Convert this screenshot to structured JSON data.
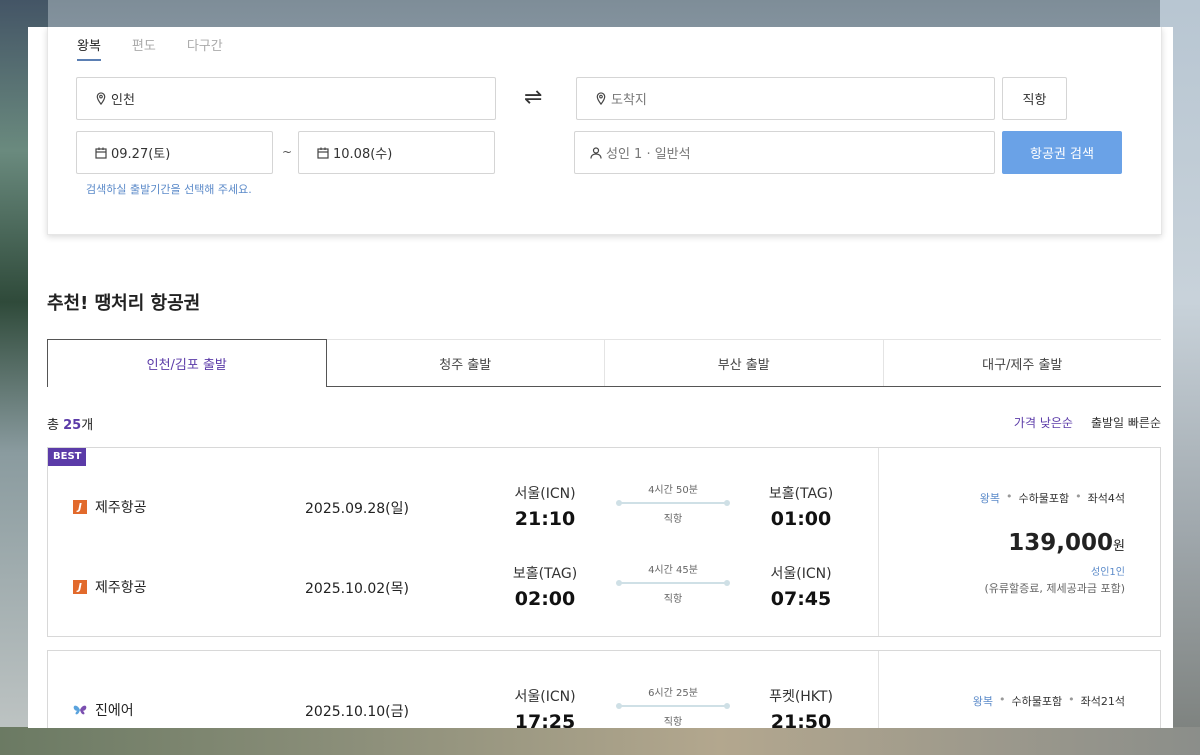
{
  "trip_tabs": [
    "왕복",
    "편도",
    "다구간"
  ],
  "search": {
    "origin": "인천",
    "destination_placeholder": "도착지",
    "depart_date": "09.27(토)",
    "tilde": "~",
    "return_date": "10.08(수)",
    "passengers": "성인 1 · 일반석",
    "hint": "검색하실 출발기간을 선택해 주세요.",
    "direct_label": "직항",
    "search_label": "항공권 검색"
  },
  "section_title": "추천! 땡처리 항공권",
  "region_tabs": [
    "인천/김포 출발",
    "청주 출발",
    "부산 출발",
    "대구/제주 출발"
  ],
  "total": {
    "prefix": "총 ",
    "count": "25",
    "suffix": "개"
  },
  "sort": [
    "가격 낮은순",
    "출발일 빠른순"
  ],
  "results": [
    {
      "badge": "BEST",
      "legs": [
        {
          "airline": "제주항공",
          "date": "2025.09.28(일)",
          "dep_airport": "서울(ICN)",
          "dep_time": "21:10",
          "duration": "4시간 50분",
          "direct": "직항",
          "arr_airport": "보홀(TAG)",
          "arr_time": "01:00"
        },
        {
          "airline": "제주항공",
          "date": "2025.10.02(목)",
          "dep_airport": "보홀(TAG)",
          "dep_time": "02:00",
          "duration": "4시간 45분",
          "direct": "직항",
          "arr_airport": "서울(ICN)",
          "arr_time": "07:45"
        }
      ],
      "trip_type": "왕복",
      "baggage": "수하물포함",
      "seats": "좌석4석",
      "price": "139,000",
      "currency": "원",
      "per_person": "성인1인",
      "included": "(유류할증료, 제세공과금 포함)"
    },
    {
      "legs": [
        {
          "airline": "진에어",
          "date": "2025.10.10(금)",
          "dep_airport": "서울(ICN)",
          "dep_time": "17:25",
          "duration": "6시간 25분",
          "direct": "직항",
          "arr_airport": "푸켓(HKT)",
          "arr_time": "21:50"
        }
      ],
      "trip_type": "왕복",
      "baggage": "수하물포함",
      "seats": "좌석21석"
    }
  ],
  "colors": {
    "accent": "#5b3ba8",
    "link": "#5b8ac9",
    "button": "#6aa2e7"
  }
}
